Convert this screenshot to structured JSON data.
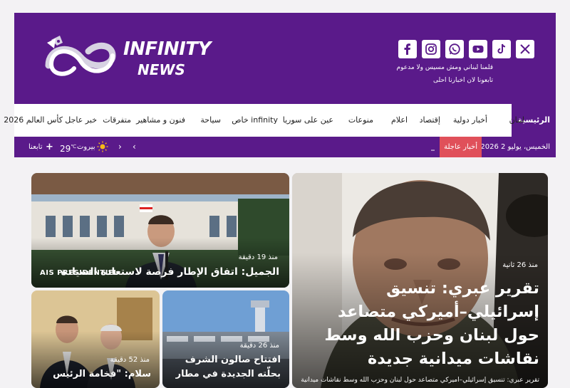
{
  "header": {
    "logo_line1": "INFINITY",
    "logo_line2": "NEWS",
    "slogan_line1": "قلمنا لبناني ومش مسيس ولا مدعوم",
    "slogan_line2": "تابعونا لان اخبارنا احلى",
    "socials": [
      "x-icon",
      "tiktok-icon",
      "youtube-icon",
      "whatsapp-icon",
      "instagram-icon",
      "facebook-icon"
    ]
  },
  "nav": {
    "items": [
      "الرئيسية",
      "لبنان",
      "أخبار دولية",
      "إقتصاد",
      "اعلام",
      "منوعات",
      "عين على سوريا",
      "خاص infinity",
      "سياحة",
      "فنون و مشاهير",
      "متفرقات",
      "خبر عاجل",
      "كأس العالم 2026"
    ]
  },
  "ticker": {
    "date": "الخميس، يوليو 2 2026",
    "breaking_label": "أخبار عاجلة",
    "city": "بيروت",
    "temp": "29",
    "temp_unit": "℃",
    "follow_label": "تابعنا"
  },
  "articles": {
    "main": {
      "time": "منذ 26 ثانية",
      "title": "تقرير عبري: تنسيق إسرائيلي–أميركي متصاعد حول لبنان وحزب الله وسط نقاشات ميدانية جديدة",
      "subtitle": "تقرير عبري: تنسيق إسرائيلي–أميركي متصاعد حول لبنان وحزب الله وسط نقاشات ميدانية"
    },
    "top_right": {
      "time": "منذ 19 دقيقة",
      "title": "الجميل: اتفاق الإطار فرصة لاستعادة السيادة",
      "sign": "AIS PRESIDENTIEL"
    },
    "bottom_mid": {
      "time": "منذ 26 دقيقة",
      "title": "افتتاح صالون الشرف بحلّته الجديدة في مطار"
    },
    "bottom_left": {
      "time": "منذ 52 دقيقة",
      "title": "سلام: \"فخامة الرئيس"
    }
  },
  "colors": {
    "brand": "#5a1a8a",
    "breaking": "#e0505a"
  }
}
